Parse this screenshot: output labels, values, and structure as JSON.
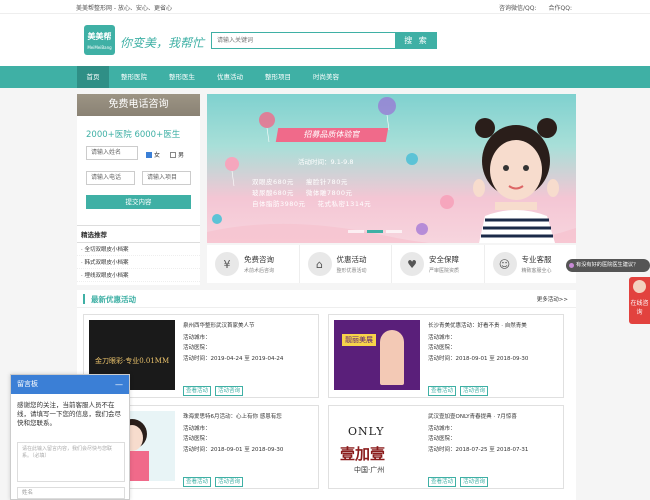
{
  "topbar": {
    "left": "美美帮整形网 - 放心、安心、更省心",
    "qq1": "咨询微信/QQ:",
    "qq2": "合作QQ:"
  },
  "header": {
    "logo_name": "美美帮",
    "logo_sub": "MeiMeiBang",
    "slogan": "你变美，我帮忙",
    "search_placeholder": "请输入关键词",
    "search_button": "搜 索"
  },
  "nav": [
    {
      "label": "首页"
    },
    {
      "label": "整形医院"
    },
    {
      "label": "整形医生"
    },
    {
      "label": "优惠活动"
    },
    {
      "label": "整形项目"
    },
    {
      "label": "时尚美容"
    }
  ],
  "sidebar": {
    "title": "免费电话咨询",
    "stats": "2000+医院  6000+医生",
    "name_placeholder": "请输入姓名",
    "gender_female": "女",
    "gender_male": "男",
    "phone_placeholder": "请输入电话",
    "project_placeholder": "请输入项目",
    "submit": "提交内容"
  },
  "recs": {
    "title": "精选推荐",
    "items": [
      "· 全切双眼皮小档案",
      "· 韩式双眼皮小档案",
      "· 埋线双眼皮小档案"
    ]
  },
  "banner": {
    "title": "招募品质体验官",
    "time": "活动时间：9.1-9.8",
    "lines": [
      [
        "双眼皮680元",
        "瘦脸针780元"
      ],
      [
        "玻尿酸680元",
        "微体雕7800元"
      ],
      [
        "自体脂肪3980元",
        "花式私密1314元"
      ]
    ]
  },
  "features": [
    {
      "icon": "¥",
      "title": "免费咨询",
      "desc": "术前术后咨询"
    },
    {
      "icon": "⌂",
      "title": "优惠活动",
      "desc": "整形优惠活动"
    },
    {
      "icon": "♥",
      "title": "安全保障",
      "desc": "严审医院资质"
    },
    {
      "icon": "☺",
      "title": "专业客服",
      "desc": "精致客服全心"
    }
  ],
  "promo": {
    "title": "最新优惠活动",
    "more": "更多活动>>",
    "cards": [
      {
        "title": "泉州西华整形武汉首家美人节",
        "l1": "活动城市：",
        "l2": "活动医院：",
        "date": "活动时间：2019-04-24 至 2019-04-24",
        "b1": "查看活动",
        "b2": "活动咨询",
        "img": "金刀眼彩·专业0.01MM"
      },
      {
        "title": "长沙青美优惠活动：好看不贵 · 自然青美",
        "l1": "活动城市：",
        "l2": "活动医院：",
        "date": "活动时间：2018-09-01 至 2018-09-30",
        "b1": "查看活动",
        "b2": "活动咨询",
        "img": "靓丽美展"
      },
      {
        "title": "珠海爱思特6月活动：心上有你 感恩有您",
        "l1": "活动城市：",
        "l2": "活动医院：",
        "date": "活动时间：2018-09-01 至 2018-09-30",
        "b1": "查看活动",
        "b2": "活动咨询",
        "img": ""
      },
      {
        "title": "武汉壹加壹ONLY青春提典 · 7月惊喜",
        "l1": "活动城市：",
        "l2": "活动医院：",
        "date": "活动时间：2018-07-25 至 2018-07-31",
        "b1": "查看活动",
        "b2": "活动咨询",
        "img": "壹加壹"
      }
    ]
  },
  "chat": {
    "title": "留言板",
    "min": "—",
    "message": "感谢您的关注，当前客服人员不在线，请填写一下您的信息，我们会尽快和您联系。",
    "textarea": "请在此输入留言内容，我们会尽快与您联系。（必填）",
    "name": "姓名"
  },
  "qa": {
    "text": "有没有好的医院医生建议？"
  },
  "online": {
    "label": "在线咨询"
  }
}
